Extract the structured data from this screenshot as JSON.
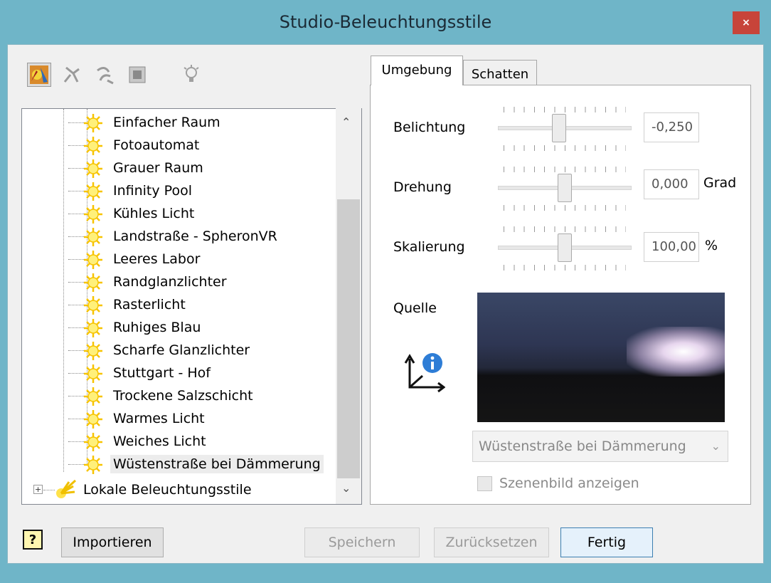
{
  "window": {
    "title": "Studio-Beleuchtungsstile",
    "close_label": "×"
  },
  "toolbar": {
    "icons": [
      "studio-lighting-icon",
      "light-icon",
      "light-variant-icon",
      "environment-icon",
      "bulb-icon"
    ]
  },
  "tree": {
    "items": [
      "Einfacher Raum",
      "Fotoautomat",
      "Grauer Raum",
      "Infinity Pool",
      "Kühles Licht",
      "Landstraße - SpheronVR",
      "Leeres Labor",
      "Randglanzlichter",
      "Rasterlicht",
      "Ruhiges Blau",
      "Scharfe Glanzlichter",
      "Stuttgart - Hof",
      "Trockene Salzschicht",
      "Warmes Licht",
      "Weiches Licht",
      "Wüstenstraße bei Dämmerung"
    ],
    "selected_index": 15,
    "root_item": "Lokale Beleuchtungsstile"
  },
  "tabs": [
    "Umgebung",
    "Schatten"
  ],
  "settings": {
    "belichtung_label": "Belichtung",
    "belichtung_value": "-0,250",
    "drehung_label": "Drehung",
    "drehung_value": "0,000",
    "drehung_unit": "Grad",
    "skalierung_label": "Skalierung",
    "skalierung_value": "100,00",
    "skalierung_unit": "%",
    "quelle_label": "Quelle",
    "source_select": "Wüstenstraße bei Dämmerung",
    "show_scene_label": "Szenenbild anzeigen"
  },
  "sliders": {
    "belichtung": 0.45,
    "drehung": 0.5,
    "skalierung": 0.5
  },
  "buttons": {
    "help": "?",
    "import": "Importieren",
    "save": "Speichern",
    "reset": "Zurücksetzen",
    "done": "Fertig"
  }
}
